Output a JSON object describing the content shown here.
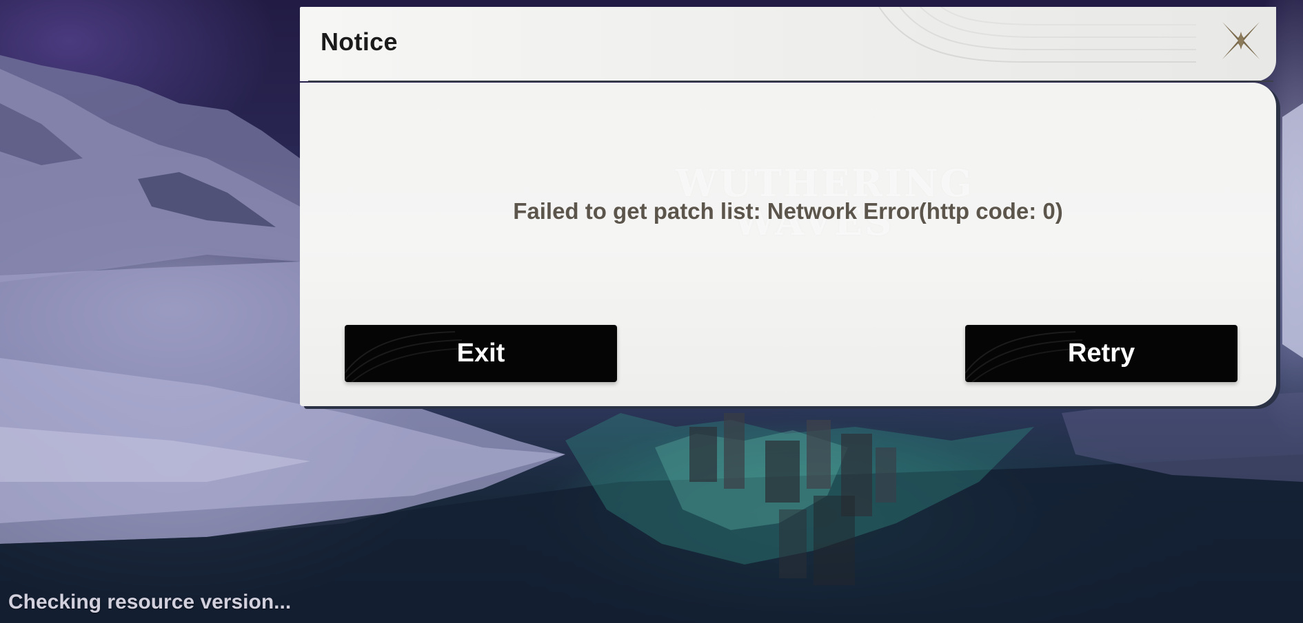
{
  "dialog": {
    "title": "Notice",
    "message": "Failed to get patch list: Network Error(http code: 0)",
    "watermark_line1": "WUTHERING",
    "watermark_line2": "WAVES",
    "close_icon": "close-x-icon",
    "buttons": {
      "exit_label": "Exit",
      "retry_label": "Retry"
    }
  },
  "status": {
    "text": "Checking resource version..."
  },
  "colors": {
    "dialog_background": "#f3f3f2",
    "button_background": "#050505",
    "message_text": "#5c554c",
    "close_icon": "#7a6a4c"
  }
}
